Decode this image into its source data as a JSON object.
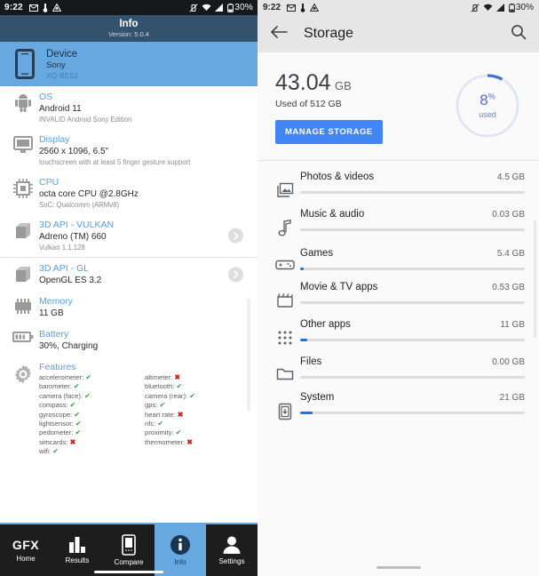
{
  "left_screen": {
    "status_bar": {
      "time": "9:22",
      "battery_percent": "30%",
      "left_icons": [
        "mail-icon",
        "thermometer-icon",
        "app-icon"
      ],
      "right_icons": [
        "vibrate-off-icon",
        "wifi-icon",
        "signal-icon",
        "battery-icon"
      ]
    },
    "app_bar": {
      "title": "Info",
      "version": "Version: 5.0.4"
    },
    "device_card": {
      "title": "Device",
      "manufacturer": "Sony",
      "model": "XQ-BE52",
      "icon": "phone-icon",
      "background": "#68a8e0"
    },
    "items": [
      {
        "icon": "android-icon",
        "title": "OS",
        "value": "Android 11",
        "note": "INVALID Android Sony Edition",
        "chevron": false
      },
      {
        "icon": "display-icon",
        "title": "Display",
        "value": "2560 x 1096, 6.5\"",
        "note": "touchscreen with at least 5 finger gesture support",
        "chevron": false
      },
      {
        "icon": "cpu-icon",
        "title": "CPU",
        "value": "octa core CPU @2.8GHz",
        "note": "SoC: Qualcomm (ARMv8)",
        "chevron": false
      },
      {
        "icon": "cube-icon",
        "title": "3D API - VULKAN",
        "value": "Adreno (TM) 660",
        "note": "Vulkan 1.1.128",
        "chevron": true
      },
      {
        "icon": "cube-icon",
        "title": "3D API - GL",
        "value": "OpenGL ES 3.2",
        "note": "",
        "chevron": true
      },
      {
        "icon": "memory-icon",
        "title": "Memory",
        "value": "11 GB",
        "note": "",
        "chevron": false
      },
      {
        "icon": "battery-icon",
        "title": "Battery",
        "value": "30%, Charging",
        "note": "",
        "chevron": false
      }
    ],
    "features": {
      "title": "Features",
      "icon": "gear-icon",
      "ok_mark": "✔",
      "no_mark": "✖",
      "left_column": [
        {
          "name": "accelerometer:",
          "supported": true
        },
        {
          "name": "barometer:",
          "supported": true
        },
        {
          "name": "camera (face):",
          "supported": true
        },
        {
          "name": "compass:",
          "supported": true
        },
        {
          "name": "gyroscope:",
          "supported": true
        },
        {
          "name": "lightsensor:",
          "supported": true
        },
        {
          "name": "pedometer:",
          "supported": true
        },
        {
          "name": "simcards:",
          "supported": false
        },
        {
          "name": "wifi:",
          "supported": true
        }
      ],
      "right_column": [
        {
          "name": "altimeter:",
          "supported": false
        },
        {
          "name": "bluetooth:",
          "supported": true
        },
        {
          "name": "camera (rear):",
          "supported": true
        },
        {
          "name": "gps:",
          "supported": true
        },
        {
          "name": "heart rate:",
          "supported": false
        },
        {
          "name": "nfc:",
          "supported": true
        },
        {
          "name": "proximity:",
          "supported": true
        },
        {
          "name": "thermometer:",
          "supported": false
        }
      ]
    },
    "bottom_nav": {
      "active_index": 3,
      "items": [
        {
          "label": "Home",
          "icon": "gfx-logo"
        },
        {
          "label": "Results",
          "icon": "bar-chart-icon"
        },
        {
          "label": "Compare",
          "icon": "phone-icon"
        },
        {
          "label": "Info",
          "icon": "info-icon"
        },
        {
          "label": "Settings",
          "icon": "person-icon"
        }
      ]
    }
  },
  "right_screen": {
    "status_bar": {
      "time": "9:22",
      "battery_percent": "30%",
      "left_icons": [
        "mail-icon",
        "thermometer-icon",
        "app-icon"
      ],
      "right_icons": [
        "vibrate-off-icon",
        "wifi-icon",
        "signal-icon",
        "battery-icon"
      ]
    },
    "app_bar": {
      "title": "Storage",
      "back_icon": "back-arrow-icon",
      "search_icon": "search-icon"
    },
    "summary": {
      "used_amount": "43.04",
      "used_unit": "GB",
      "of_text": "Used of 512 GB",
      "manage_button": "MANAGE STORAGE",
      "donut_percent": "8",
      "donut_percent_symbol": "%",
      "donut_caption": "used",
      "accent_color": "#4285f4",
      "donut_arc_color": "#3f6fd8",
      "donut_track_color": "#dfe4f5"
    },
    "categories": [
      {
        "icon": "photos-icon",
        "name": "Photos & videos",
        "size": "4.5 GB",
        "bar_percent": 0
      },
      {
        "icon": "music-icon",
        "name": "Music & audio",
        "size": "0.03 GB",
        "bar_percent": 0
      },
      {
        "icon": "games-icon",
        "name": "Games",
        "size": "5.4 GB",
        "bar_percent": 1.5
      },
      {
        "icon": "movie-icon",
        "name": "Movie & TV apps",
        "size": "0.53 GB",
        "bar_percent": 0
      },
      {
        "icon": "apps-icon",
        "name": "Other apps",
        "size": "11 GB",
        "bar_percent": 3
      },
      {
        "icon": "folder-icon",
        "name": "Files",
        "size": "0.00 GB",
        "bar_percent": 0
      },
      {
        "icon": "system-icon",
        "name": "System",
        "size": "21 GB",
        "bar_percent": 5.5
      }
    ]
  }
}
